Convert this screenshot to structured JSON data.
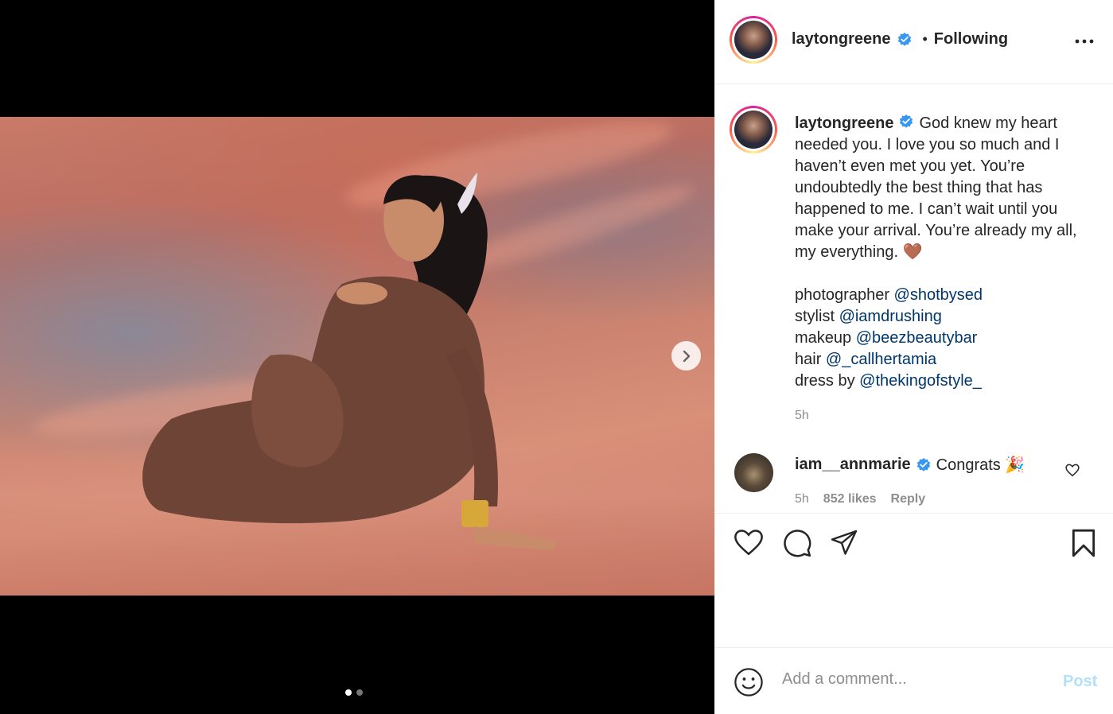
{
  "post": {
    "username": "laytongreene",
    "follow_status": "Following",
    "separator": "•",
    "more_icon": "more-horizontal-icon"
  },
  "caption": {
    "username": "laytongreene",
    "text": "God knew my heart needed you. I love you so much and I haven’t even met you yet. You’re undoubtedly the best thing that has happened to me. I can’t wait until you make your arrival. You’re already my all, my everything. 🤎",
    "credits": [
      {
        "role": "photographer",
        "handle": "@shotbysed"
      },
      {
        "role": "stylist",
        "handle": "@iamdrushing"
      },
      {
        "role": "makeup",
        "handle": "@beezbeautybar"
      },
      {
        "role": "hair",
        "handle": "@_callhertamia"
      },
      {
        "role": "dress by",
        "handle": "@thekingofstyle_"
      }
    ],
    "time": "5h"
  },
  "comment": {
    "username": "iam__annmarie",
    "text": "Congrats 🎉",
    "time": "5h",
    "likes": "852 likes",
    "reply_label": "Reply"
  },
  "carousel": {
    "slide_count": 2,
    "active_index": 0
  },
  "composer": {
    "placeholder": "Add a comment...",
    "post_label": "Post"
  },
  "colors": {
    "verified": "#3897f0",
    "mention": "#00376b",
    "post_disabled": "#b2dffc"
  }
}
